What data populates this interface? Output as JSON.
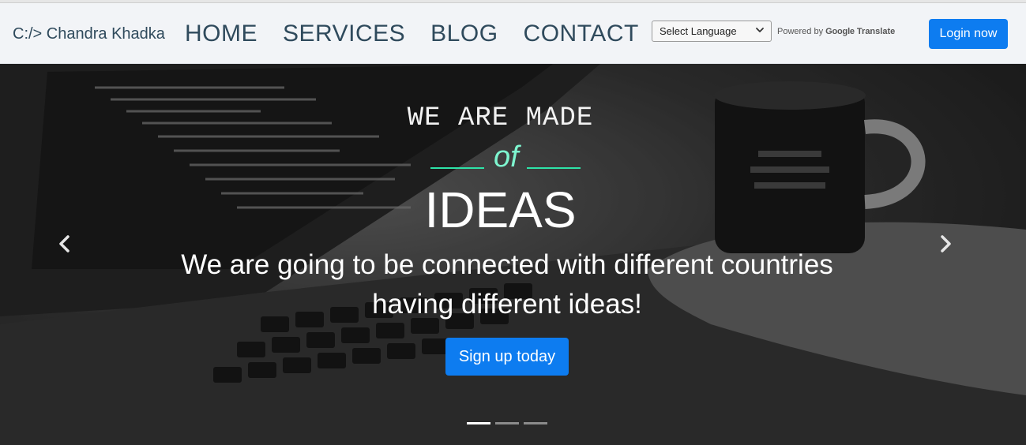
{
  "navbar": {
    "brand": "C:/> Chandra Khadka",
    "links": [
      "HOME",
      "SERVICES",
      "BLOG",
      "CONTACT"
    ],
    "language_select": {
      "value": "Select Language"
    },
    "powered_by": {
      "prefix": "Powered by",
      "google": "Google",
      "translate": "Translate"
    },
    "login_label": "Login now"
  },
  "hero": {
    "made": "WE ARE MADE",
    "of": "of",
    "ideas": "IDEAS",
    "tagline": "We are going to be connected with different countries having different ideas!",
    "signup_label": "Sign up today",
    "active_slide": 1,
    "slide_count": 3
  },
  "icons": {
    "prev": "chevron-left-icon",
    "next": "chevron-right-icon",
    "select": "chevron-down-icon"
  },
  "colors": {
    "accent_blue": "#0d7cf0",
    "of_green": "#7ef5cf",
    "nav_text": "#2f4a5c"
  }
}
